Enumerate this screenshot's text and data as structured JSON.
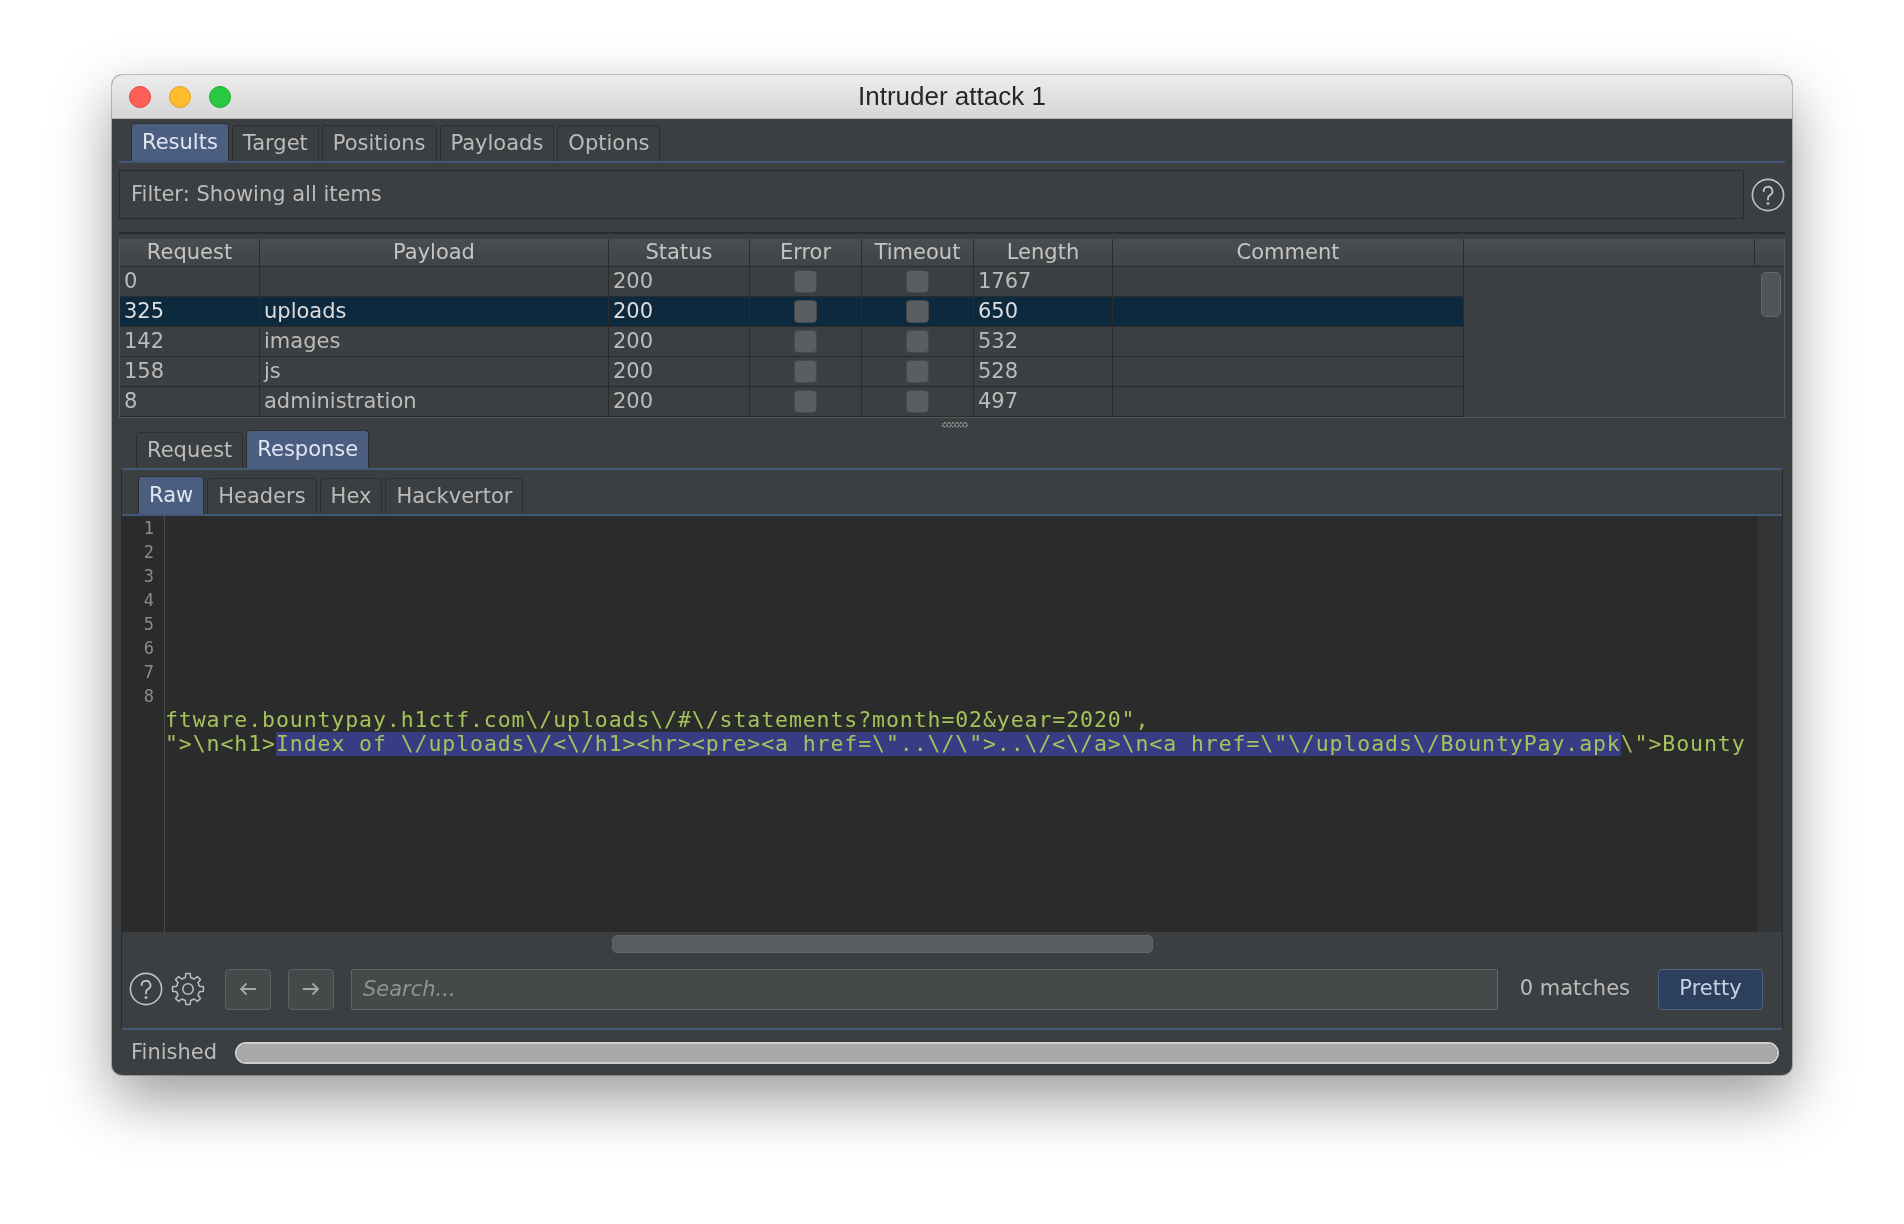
{
  "window": {
    "title": "Intruder attack 1"
  },
  "tabs": [
    {
      "label": "Results",
      "selected": true
    },
    {
      "label": "Target",
      "selected": false
    },
    {
      "label": "Positions",
      "selected": false
    },
    {
      "label": "Payloads",
      "selected": false
    },
    {
      "label": "Options",
      "selected": false
    }
  ],
  "filter": {
    "text": "Filter: Showing all items"
  },
  "table": {
    "columns": [
      "Request",
      "Payload",
      "Status",
      "Error",
      "Timeout",
      "Length",
      "Comment"
    ],
    "rows": [
      {
        "request": "0",
        "status": "200",
        "error": false,
        "timeout": false,
        "length": "1767",
        "selected": false
      },
      {
        "request": "325",
        "payload": "uploads",
        "status": "200",
        "error": false,
        "timeout": false,
        "length": "650",
        "selected": true
      },
      {
        "request": "142",
        "payload": "images",
        "status": "200",
        "error": false,
        "timeout": false,
        "length": "532",
        "selected": false
      },
      {
        "request": "158",
        "payload": "js",
        "status": "200",
        "error": false,
        "timeout": false,
        "length": "528",
        "selected": false
      },
      {
        "request": "8",
        "payload": "administration",
        "status": "200",
        "error": false,
        "timeout": false,
        "length": "497",
        "selected": false
      }
    ]
  },
  "message_tabs": [
    {
      "label": "Request",
      "selected": false
    },
    {
      "label": "Response",
      "selected": true
    }
  ],
  "view_tabs": [
    {
      "label": "Raw",
      "selected": true
    },
    {
      "label": "Headers",
      "selected": false
    },
    {
      "label": "Hex",
      "selected": false
    },
    {
      "label": "Hackvertor",
      "selected": false
    }
  ],
  "editor": {
    "line_numbers": [
      "1",
      "2",
      "3",
      "4",
      "5",
      "6",
      "7",
      "8"
    ],
    "lines": [
      {
        "segments": [
          {
            "text": "ftware.bountypay.h1ctf.com\\/uploads\\/#\\/statements?month=02&year=2020\",",
            "selected": false
          }
        ]
      },
      {
        "segments": [
          {
            "text": "\">\\n<h1>",
            "selected": false
          },
          {
            "text": "Index of \\/uploads\\/<\\/h1><hr><pre><a href=\\\"..\\/\\\">..\\/<\\/a>\\n<a href=\\\"\\/uploads\\/BountyPay.apk",
            "selected": true
          },
          {
            "text": "\\\">Bounty",
            "selected": false
          }
        ]
      }
    ]
  },
  "search": {
    "placeholder": "Search...",
    "matches": "0 matches"
  },
  "pretty_button": {
    "label": "Pretty"
  },
  "status_bar": {
    "text": "Finished",
    "progress": {
      "level": 1
    }
  }
}
